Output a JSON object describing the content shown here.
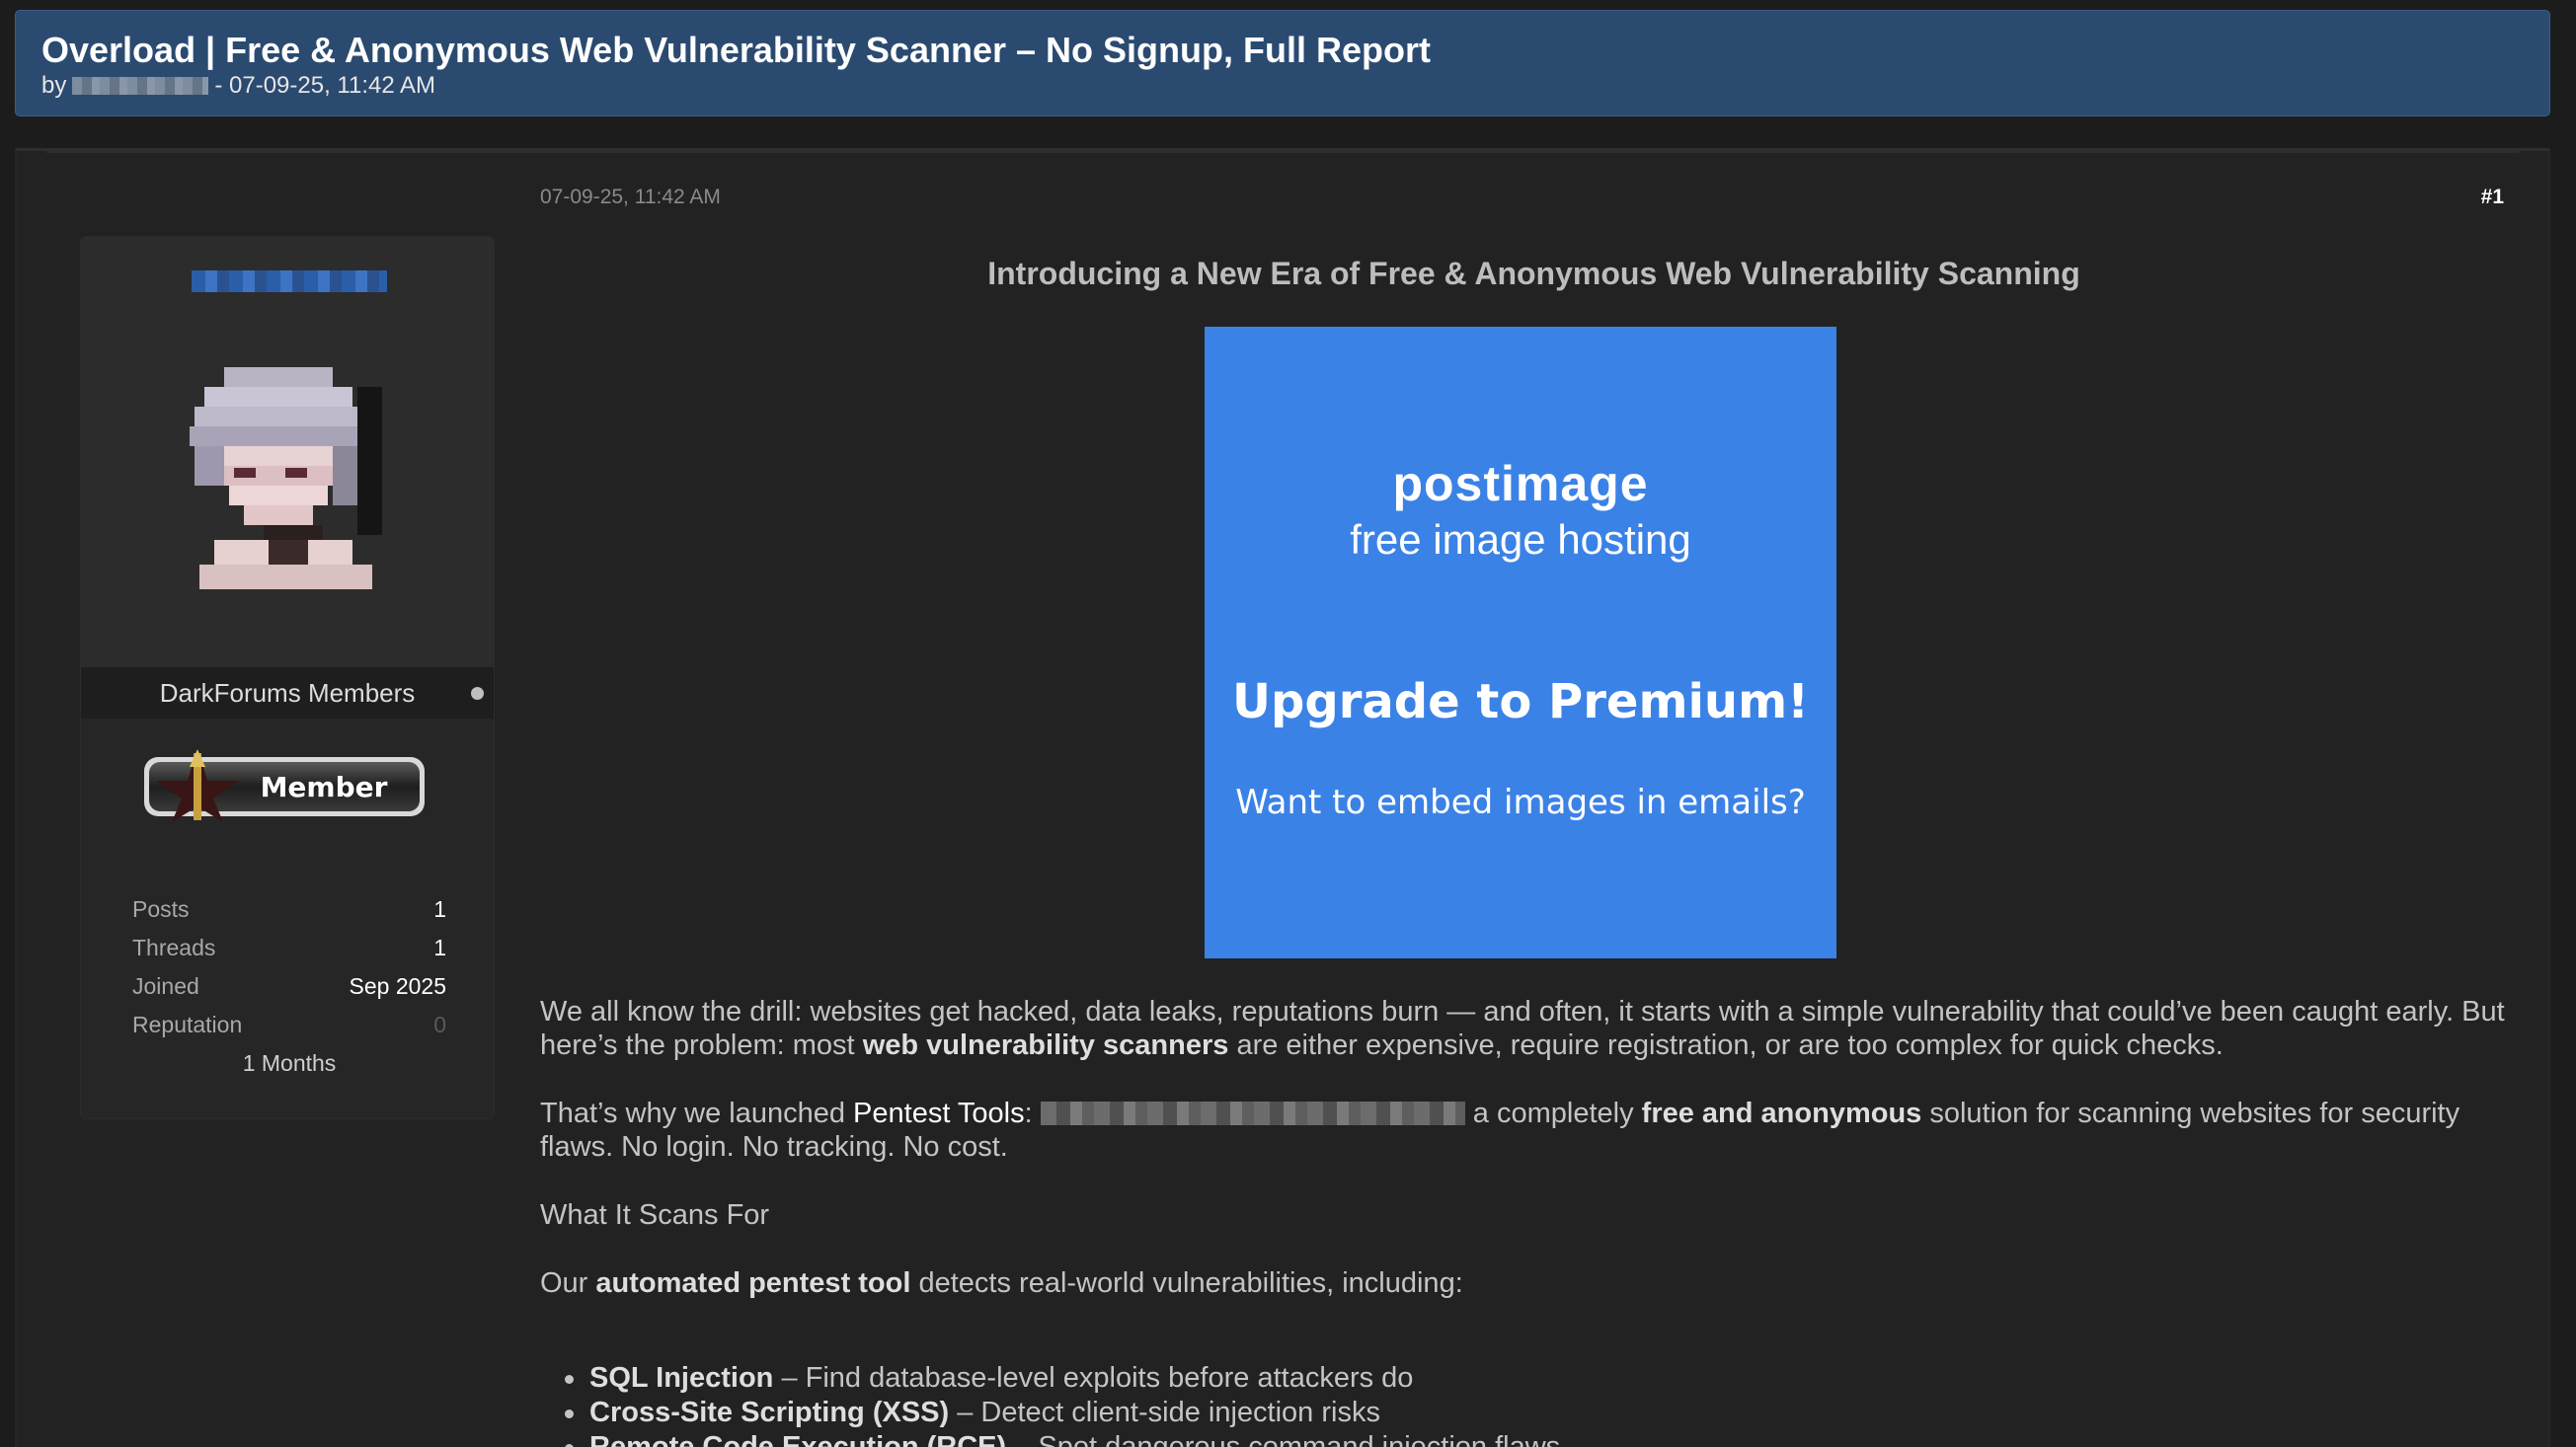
{
  "thread": {
    "title": "Overload | Free & Anonymous Web Vulnerability Scanner – No Signup, Full Report",
    "by_label": "by",
    "byline_suffix": "- 07-09-25, 11:42 AM"
  },
  "post": {
    "date": "07-09-25, 11:42 AM",
    "number": "#1",
    "heading": "Introducing a New Era of Free & Anonymous Web Vulnerability Scanning",
    "image": {
      "logo": "postimage",
      "subtitle": "free image hosting",
      "headline": "Upgrade to Premium!",
      "caption": "Want to embed images in emails?",
      "background": "#3b82e6"
    },
    "p1": {
      "a": "We all know the drill: websites get hacked, data leaks, reputations burn — and often, it starts with a simple vulnerability that could’ve been caught early. But here’s the problem: most ",
      "b": "web vulnerability scanners",
      "c": " are either expensive, require registration, or are too complex for quick checks."
    },
    "p2": {
      "a": "That’s why we launched ",
      "tool": "Pentest Tools",
      "colon": ": ",
      "b": " a completely ",
      "c": "free and anonymous",
      "d": " solution for scanning websites for security flaws. No login. No tracking. No cost."
    },
    "p3": "What It Scans For",
    "p4": {
      "a": "Our ",
      "b": "automated pentest tool",
      "c": " detects real-world vulnerabilities, including:"
    },
    "vulns": [
      {
        "name": "SQL Injection",
        "desc": " – Find database-level exploits before attackers do"
      },
      {
        "name": "Cross-Site Scripting (XSS)",
        "desc": " – Detect client-side injection risks"
      },
      {
        "name": "Remote Code Execution (RCE)",
        "desc": " – Spot dangerous command injection flaws"
      }
    ]
  },
  "user": {
    "group": "DarkForums Members",
    "badge": "Member",
    "stats": [
      {
        "label": "Posts",
        "value": "1"
      },
      {
        "label": "Threads",
        "value": "1"
      },
      {
        "label": "Joined",
        "value": "Sep 2025"
      },
      {
        "label": "Reputation",
        "value": "0"
      }
    ],
    "months": "1 Months"
  },
  "colors": {
    "header_bg": "#2b4a70",
    "page_bg": "#1c1c1c",
    "post_bg": "#222222"
  }
}
